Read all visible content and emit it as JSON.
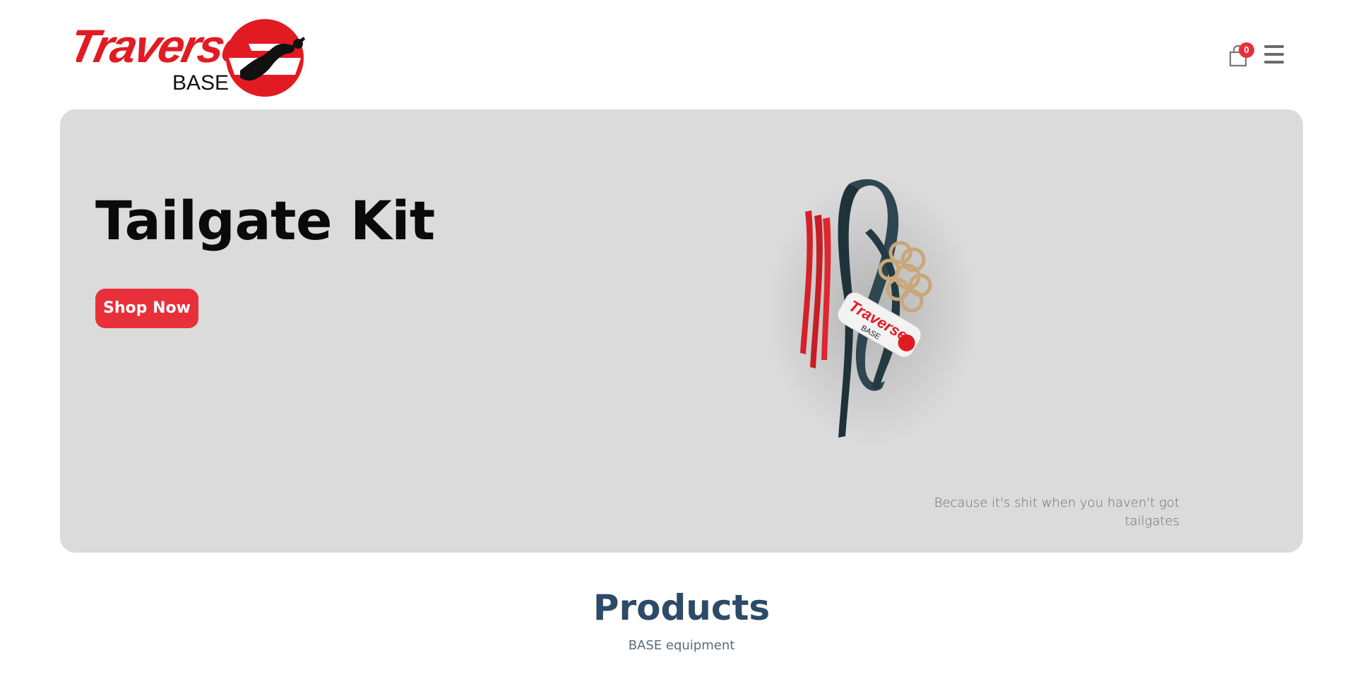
{
  "header": {
    "logo": {
      "wordmark": "Traverse",
      "subtext": "BASE",
      "icon": "skydiver-logo-icon"
    },
    "cart": {
      "icon": "shopping-bag-icon",
      "count": "0"
    },
    "menu": {
      "icon": "hamburger-menu-icon"
    }
  },
  "hero": {
    "title": "Tailgate Kit",
    "cta_label": "Shop Now",
    "tagline": "Because it's shit when you haven't got tailgates",
    "background": "#dbdbdb",
    "accent": "#e8303a"
  },
  "products_section": {
    "title": "Products",
    "subtitle": "BASE equipment"
  }
}
